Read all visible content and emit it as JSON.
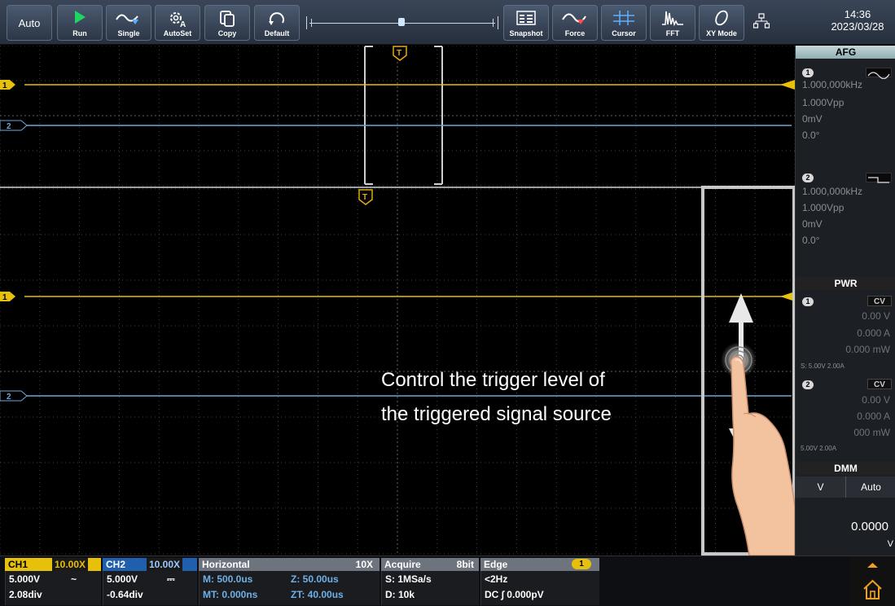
{
  "toolbar": {
    "auto_label": "Auto",
    "buttons": [
      {
        "label": "Run",
        "icon": "play-icon"
      },
      {
        "label": "Single",
        "icon": "single-trigger-icon"
      },
      {
        "label": "AutoSet",
        "icon": "autoset-gear-icon"
      },
      {
        "label": "Copy",
        "icon": "copy-icon"
      },
      {
        "label": "Default",
        "icon": "default-reset-icon"
      },
      {
        "label": "Snapshot",
        "icon": "snapshot-icon"
      },
      {
        "label": "Force",
        "icon": "force-trigger-icon"
      },
      {
        "label": "Cursor",
        "icon": "cursor-icon"
      },
      {
        "label": "FFT",
        "icon": "fft-icon"
      },
      {
        "label": "XY Mode",
        "icon": "xy-mode-icon"
      }
    ],
    "time": "14:36",
    "date": "2023/03/28"
  },
  "scope": {
    "trigger_marker": "T",
    "channel_markers": [
      "1",
      "2"
    ],
    "annotation_line1": "Control the trigger level of",
    "annotation_line2": "the triggered signal source"
  },
  "side": {
    "afg": {
      "title": "AFG",
      "ch1": {
        "id": "1",
        "freq": "1.000,000kHz",
        "amp": "1.000Vpp",
        "offset": "0mV",
        "phase": "0.0°",
        "wave": "sine"
      },
      "ch2": {
        "id": "2",
        "freq": "1.000,000kHz",
        "amp": "1.000Vpp",
        "offset": "0mV",
        "phase": "0.0°",
        "wave": "square"
      }
    },
    "pwr": {
      "title": "PWR",
      "ch1": {
        "id": "1",
        "mode": "CV",
        "voltage": "0.00 V",
        "current": "0.000 A",
        "power": "0.000 mW",
        "set": "S: 5.00V 2.00A"
      },
      "ch2": {
        "id": "2",
        "mode": "CV",
        "voltage": "0.00 V",
        "current": "0.000 A",
        "power": "000 mW",
        "set": "5.00V 2.00A"
      }
    },
    "dmm": {
      "title": "DMM",
      "mode": "V",
      "range": "Auto",
      "reading": "0.0000",
      "unit": "V"
    }
  },
  "status": {
    "ch1": {
      "name": "CH1",
      "atten": "10.00X",
      "scale": "5.000V",
      "coupling": "~",
      "offset": "2.08div"
    },
    "ch2": {
      "name": "CH2",
      "atten": "10.00X",
      "scale": "5.000V",
      "coupling": "⎓",
      "offset": "-0.64div"
    },
    "horizontal": {
      "title": "Horizontal",
      "zoom": "10X",
      "m": "M: 500.0us",
      "z": "Z: 50.00us",
      "mt": "MT: 0.000ns",
      "zt": "ZT: 40.00us"
    },
    "acquire": {
      "title": "Acquire",
      "bits": "8bit",
      "rate": "S: 1MSa/s",
      "depth": "D: 10k"
    },
    "trigger": {
      "title": "Edge",
      "source": "1",
      "freq": "<2Hz",
      "level": "DC ∫ 0.000pV"
    }
  },
  "colors": {
    "ch1": "#e6c00a",
    "ch2": "#6fa6d6",
    "grid": "#555a60",
    "accent_header": "#90aeb2"
  }
}
